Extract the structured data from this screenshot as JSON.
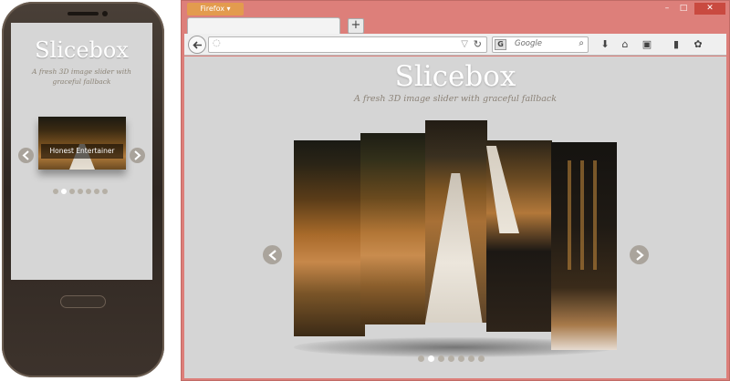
{
  "mobile": {
    "title": "Slicebox",
    "subtitle": "A fresh 3D image slider with graceful fallback",
    "caption": "Honest Entertainer",
    "dots": [
      false,
      true,
      false,
      false,
      false,
      false,
      false
    ],
    "prev_icon": "chevron-left-icon",
    "next_icon": "chevron-right-icon"
  },
  "browser": {
    "app_menu_label": "Firefox",
    "window_controls": {
      "minimize": "–",
      "maximize": "□",
      "close": "✕"
    },
    "new_tab_label": "+",
    "url_value": "",
    "search_engine": "G",
    "search_placeholder": "Google",
    "toolbar_icons": [
      "download-icon",
      "home-icon",
      "bookmarks-menu-icon",
      "reader-icon",
      "addon-icon"
    ]
  },
  "page": {
    "title": "Slicebox",
    "subtitle": "A fresh 3D image slider with graceful fallback",
    "dots": [
      false,
      true,
      false,
      false,
      false,
      false,
      false
    ],
    "prev_icon": "chevron-left-icon",
    "next_icon": "chevron-right-icon"
  },
  "colors": {
    "window_frame": "#dd7f7a",
    "content_bg": "#d5d5d5",
    "title_text": "#ffffff",
    "subtitle_text": "#8b8277",
    "firefox_button": "#e39b4e"
  }
}
